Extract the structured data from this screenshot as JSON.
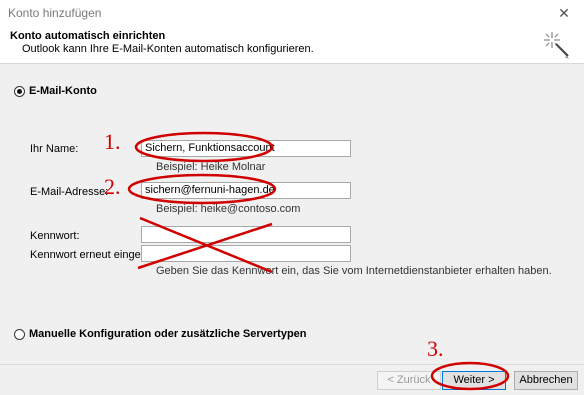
{
  "window": {
    "title": "Konto hinzufügen",
    "close_glyph": "✕"
  },
  "header": {
    "title": "Konto automatisch einrichten",
    "subtitle": "Outlook kann Ihre E-Mail-Konten automatisch konfigurieren.",
    "icon": "wizard-sparkle-icon"
  },
  "email_account": {
    "radio_label": "E-Mail-Konto",
    "selected": true,
    "name_label": "Ihr Name:",
    "name_value": "Sichern, Funktionsaccount",
    "name_example": "Beispiel: Heike Molnar",
    "email_label": "E-Mail-Adresse:",
    "email_value": "sichern@fernuni-hagen.de",
    "email_example": "Beispiel: heike@contoso.com",
    "password_label": "Kennwort:",
    "password_confirm_label": "Kennwort erneut eingeben:",
    "password_hint": "Geben Sie das Kennwort ein, das Sie vom Internetdienstanbieter erhalten haben."
  },
  "manual_config": {
    "radio_label": "Manuelle Konfiguration oder zusätzliche Servertypen",
    "selected": false
  },
  "footer": {
    "back_label": "< Zurück",
    "next_label": "Weiter >",
    "cancel_label": "Abbrechen"
  },
  "annotations": {
    "step1": "1.",
    "step2": "2.",
    "step3": "3.",
    "color": "#d00000"
  }
}
